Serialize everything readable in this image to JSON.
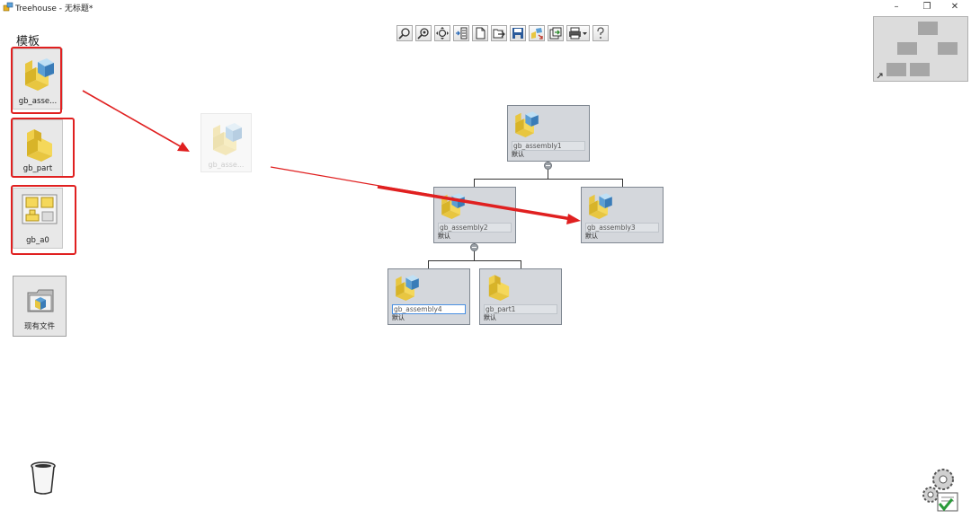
{
  "window": {
    "title": "Treehouse - 无标题*",
    "minimize_glyph": "–",
    "restore_glyph": "❐",
    "close_glyph": "✕"
  },
  "templates": {
    "heading": "模板",
    "items": [
      {
        "label": "gb_asse...",
        "icon": "assembly-icon"
      },
      {
        "label": "gb_part",
        "icon": "part-icon"
      },
      {
        "label": "gb_a0",
        "icon": "drawing-icon"
      }
    ]
  },
  "drag_preview": {
    "label": "gb_asse...",
    "icon": "assembly-icon"
  },
  "existing_files": {
    "label": "现有文件",
    "icon": "folder-icon"
  },
  "toolbar": {
    "buttons": [
      {
        "icon": "zoom-icon"
      },
      {
        "icon": "zoom-fit-icon"
      },
      {
        "icon": "pan-icon"
      },
      {
        "icon": "layout-icon"
      },
      {
        "icon": "new-document-icon"
      },
      {
        "icon": "open-icon"
      },
      {
        "icon": "save-icon"
      },
      {
        "icon": "reorganize-icon"
      },
      {
        "icon": "export-icon"
      },
      {
        "icon": "print-icon"
      },
      {
        "icon": "help-icon"
      }
    ]
  },
  "tree": {
    "nodes": [
      {
        "name": "gb_assembly1",
        "config": "默认",
        "type": "assembly"
      },
      {
        "name": "gb_assembly2",
        "config": "默认",
        "type": "assembly"
      },
      {
        "name": "gb_assembly3",
        "config": "默认",
        "type": "assembly"
      },
      {
        "name": "gb_assembly4",
        "config": "默认",
        "type": "assembly"
      },
      {
        "name": "gb_part1",
        "config": "默认",
        "type": "part"
      }
    ]
  },
  "colors": {
    "highlight": "#e02020",
    "node_bg": "#d4d7dc",
    "annotation_arrow": "#e02020"
  }
}
